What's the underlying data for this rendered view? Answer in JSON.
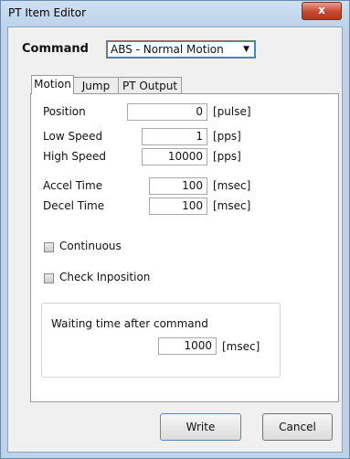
{
  "window": {
    "title": "PT Item Editor",
    "close_label": "x"
  },
  "command": {
    "label": "Command",
    "selected": "ABS - Normal Motion"
  },
  "tabs": [
    {
      "label": "Motion"
    },
    {
      "label": "Jump"
    },
    {
      "label": "PT Output"
    }
  ],
  "motion": {
    "position": {
      "label": "Position",
      "value": "0",
      "unit": "[pulse]"
    },
    "low_speed": {
      "label": "Low Speed",
      "value": "1",
      "unit": "[pps]"
    },
    "high_speed": {
      "label": "High Speed",
      "value": "10000",
      "unit": "[pps]"
    },
    "accel_time": {
      "label": "Accel Time",
      "value": "100",
      "unit": "[msec]"
    },
    "decel_time": {
      "label": "Decel Time",
      "value": "100",
      "unit": "[msec]"
    },
    "continuous": {
      "label": "Continuous",
      "checked": false
    },
    "check_inposition": {
      "label": "Check Inposition",
      "checked": false
    },
    "waiting": {
      "label": "Waiting time after command",
      "value": "1000",
      "unit": "[msec]"
    }
  },
  "buttons": {
    "write": "Write",
    "cancel": "Cancel"
  }
}
